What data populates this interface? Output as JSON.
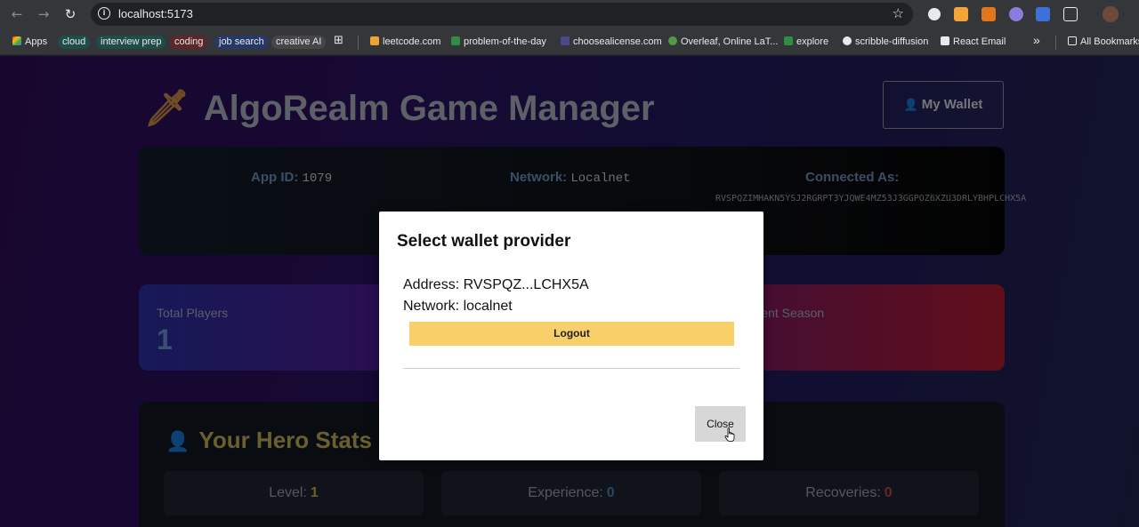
{
  "browser": {
    "url": "localhost:5173",
    "bookmarks": [
      {
        "label": "Apps"
      },
      {
        "label": "cloud",
        "color": "#1f5a56"
      },
      {
        "label": "interview prep",
        "color": "#1f5a56"
      },
      {
        "label": "coding",
        "color": "#6b2a2a"
      },
      {
        "label": "job search",
        "color": "#2a3b6b"
      },
      {
        "label": "creative AI",
        "color": "#4a4a4a"
      },
      {
        "label": "leetcode.com"
      },
      {
        "label": "problem-of-the-day"
      },
      {
        "label": "choosealicense.com"
      },
      {
        "label": "Overleaf, Online LaT..."
      },
      {
        "label": "explore"
      },
      {
        "label": "scribble-diffusion"
      },
      {
        "label": "React Email"
      },
      {
        "label": "All Bookmarks"
      }
    ]
  },
  "app": {
    "title": "AlgoRealm Game Manager",
    "title_icon": "sword-icon",
    "wallet_button": "My Wallet"
  },
  "info": {
    "app_id_label": "App ID:",
    "app_id": "1079",
    "network_label": "Network:",
    "network": "Localnet",
    "connected_label": "Connected As:",
    "address": "RVSPQZIMHAKN5YSJ2RGRPT3YJQWE4MZ53J3GGPOZ6XZU3DRLYBHPLCHX5A"
  },
  "stats": {
    "total_players_label": "Total Players",
    "total_players": "1",
    "current_season_label": "rrent Season"
  },
  "hero": {
    "title": "Your Hero Stats",
    "level_label": "Level:",
    "level": "1",
    "experience_label": "Experience:",
    "experience": "0",
    "recoveries_label": "Recoveries:",
    "recoveries": "0"
  },
  "modal": {
    "title": "Select wallet provider",
    "address_line": "Address: RVSPQZ...LCHX5A",
    "network_line": "Network: localnet",
    "logout_label": "Logout",
    "close_label": "Close"
  },
  "colors": {
    "logout_button": "#f8d06a",
    "hero_title": "#c2ad56",
    "level_value": "#c2b04a",
    "experience_value": "#4f7fb8",
    "recoveries_value": "#b84848"
  }
}
